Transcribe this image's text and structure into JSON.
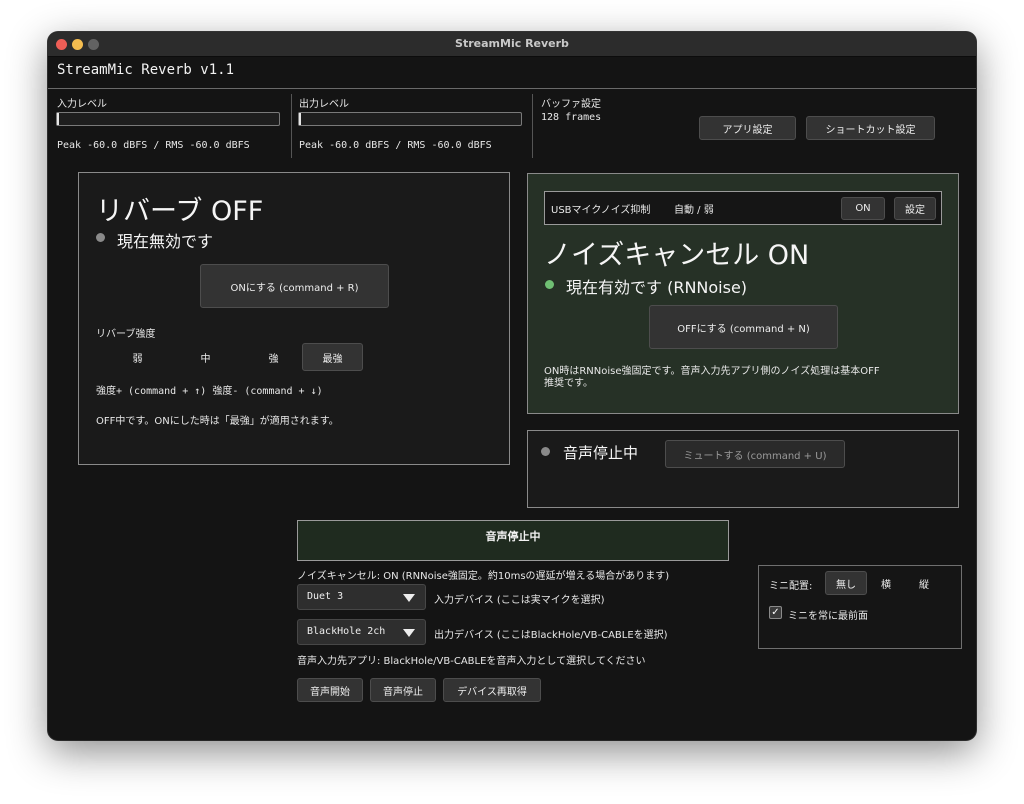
{
  "window": {
    "title": "StreamMic Reverb",
    "app_title": "StreamMic Reverb v1.1"
  },
  "levels": {
    "input": {
      "label": "入力レベル",
      "readout": "Peak -60.0 dBFS / RMS -60.0 dBFS"
    },
    "output": {
      "label": "出力レベル",
      "readout": "Peak -60.0 dBFS / RMS -60.0 dBFS"
    }
  },
  "buffer": {
    "label": "バッファ設定",
    "value": "128 frames"
  },
  "top_buttons": {
    "app_settings": "アプリ設定",
    "shortcut_settings": "ショートカット設定"
  },
  "reverb": {
    "title": "リバーブ OFF",
    "status": "現在無効です",
    "status_color": "#8a8a8a",
    "toggle_button": "ONにする (command + R)",
    "strength_label": "リバーブ強度",
    "strengths": [
      "弱",
      "中",
      "強",
      "最強"
    ],
    "selected_strength": "最強",
    "shortcuts": "強度+ (command + ↑)   強度- (command + ↓)",
    "note": "OFF中です。ONにした時は「最強」が適用されます。"
  },
  "noise": {
    "usb_label": "USBマイクノイズ抑制",
    "usb_mode": "自動 / 弱",
    "usb_on_button": "ON",
    "usb_settings_button": "設定",
    "title": "ノイズキャンセル ON",
    "status": "現在有効です (RNNoise)",
    "status_color": "#6fbf73",
    "panel_color": "#263126",
    "toggle_button": "OFFにする (command + N)",
    "note_line1": "ON時はRNNoise強固定です。音声入力先アプリ側のノイズ処理は基本OFF",
    "note_line2": "推奨です。"
  },
  "mute": {
    "status": "音声停止中",
    "button": "ミュートする (command + U)"
  },
  "bottom": {
    "status_banner": "音声停止中",
    "noise_info": "ノイズキャンセル: ON (RNNoise強固定。約10msの遅延が増える場合があります)",
    "input_device": {
      "value": "Duet 3",
      "label": "入力デバイス (ここは実マイクを選択)"
    },
    "output_device": {
      "value": "BlackHole 2ch",
      "label": "出力デバイス (ここはBlackHole/VB-CABLEを選択)"
    },
    "hint": "音声入力先アプリ: BlackHole/VB-CABLEを音声入力として選択してください",
    "buttons": {
      "start": "音声開始",
      "stop": "音声停止",
      "refresh": "デバイス再取得"
    }
  },
  "mini": {
    "label": "ミニ配置:",
    "options": [
      "無し",
      "横",
      "縦"
    ],
    "selected": "無し",
    "always_on_top_label": "ミニを常に最前面",
    "always_on_top_checked": "✓"
  }
}
